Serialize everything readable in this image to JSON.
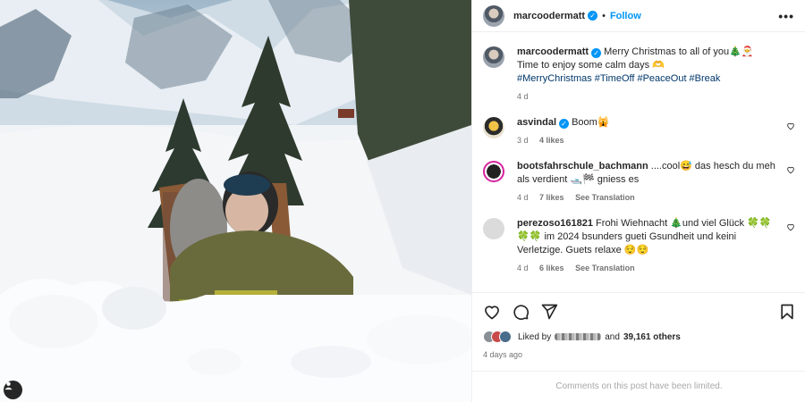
{
  "post": {
    "author": "marcoodermatt",
    "follow_label": "Follow",
    "separator": "•",
    "more_label": "•••"
  },
  "caption": {
    "user": "marcoodermatt",
    "line1": "Merry Christmas to all of you🎄🎅",
    "line2": "Time to enjoy some calm days 🫶",
    "hashtags": "#MerryChristmas #TimeOff #PeaceOut #Break",
    "time": "4 d"
  },
  "comments": [
    {
      "user": "asvindal",
      "verified": true,
      "text": "Boom🙀",
      "time": "3 d",
      "likes": "4 likes",
      "translate": ""
    },
    {
      "user": "bootsfahrschule_bachmann",
      "verified": false,
      "text": " ....cool😅 das hesch du meh als verdient 🛥️🏁 gniess es",
      "time": "4 d",
      "likes": "7 likes",
      "translate": "See Translation"
    },
    {
      "user": "perezoso161821",
      "verified": false,
      "text": " Frohi Wiehnacht 🎄und viel Glück 🍀🍀🍀🍀 im 2024 bsunders gueti Gsundheit und keini Verletzige. Guets relaxe 😌😌",
      "time": "4 d",
      "likes": "6 likes",
      "translate": "See Translation"
    }
  ],
  "likes": {
    "prefix": "Liked by",
    "middle": "and",
    "count": "39,161 others"
  },
  "date": "4 days ago",
  "footer": "Comments on this post have been limited.",
  "icons": [
    "heart-icon",
    "comment-icon",
    "share-icon",
    "bookmark-icon",
    "more-icon",
    "user-tag-icon",
    "verified-icon"
  ]
}
